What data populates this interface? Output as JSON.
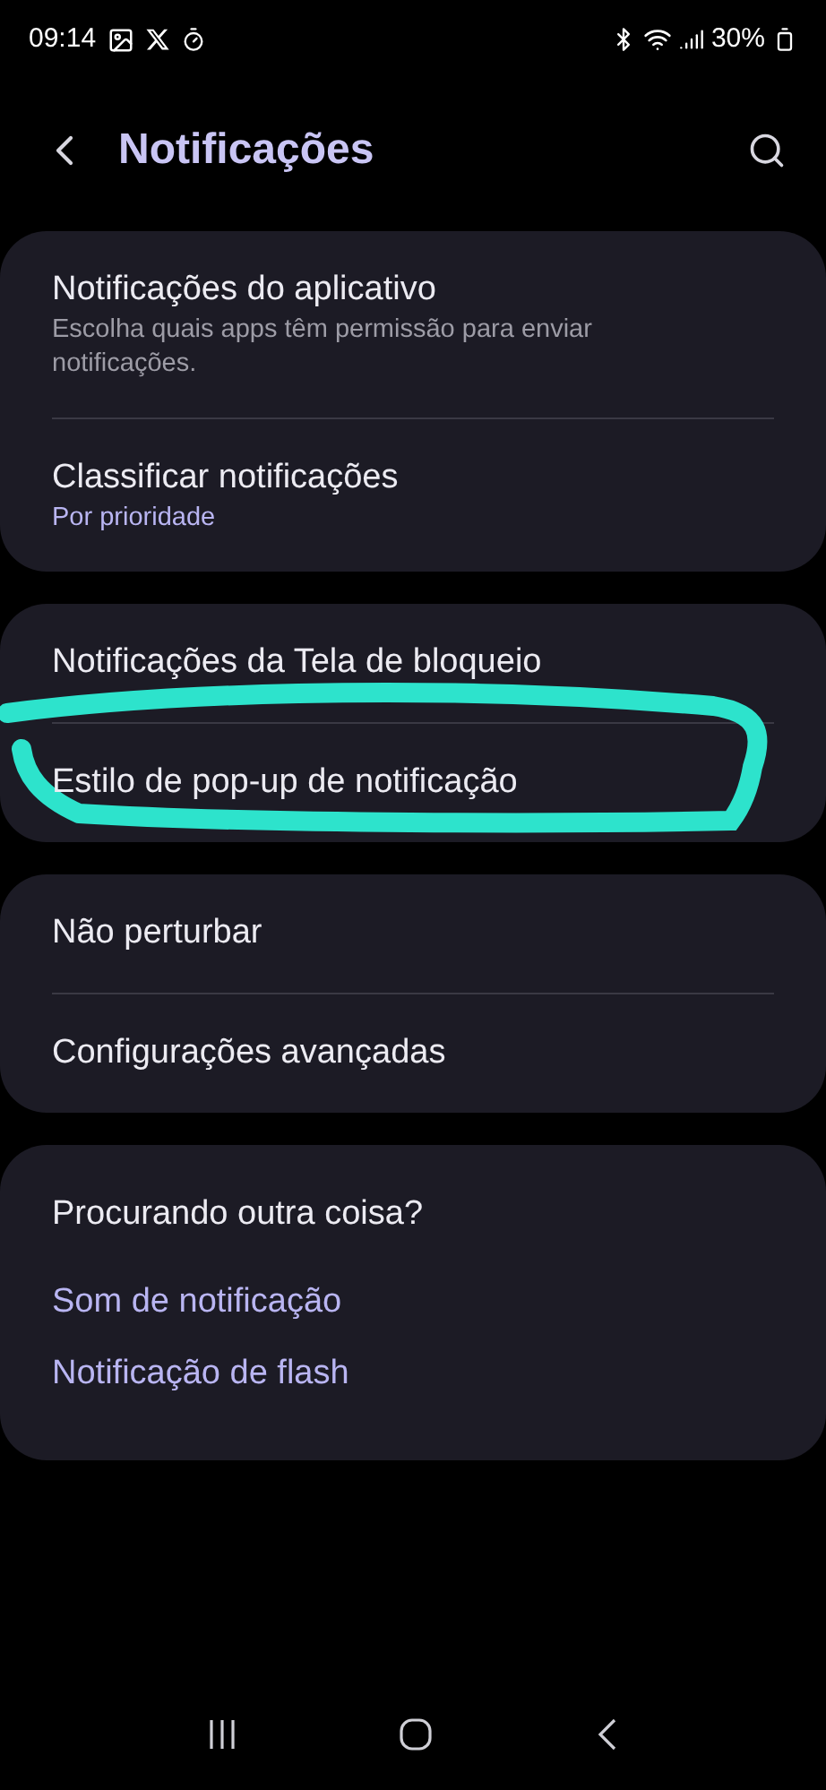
{
  "status_bar": {
    "time": "09:14",
    "battery": "30%"
  },
  "header": {
    "title": "Notificações"
  },
  "groups": [
    {
      "kind": "list",
      "items": [
        {
          "title": "Notificações do aplicativo",
          "subtitle": "Escolha quais apps têm permissão para enviar notificações.",
          "kind": "description"
        },
        {
          "title": "Classificar notificações",
          "subtitle": "Por prioridade",
          "kind": "value"
        }
      ]
    },
    {
      "kind": "list",
      "items": [
        {
          "title": "Notificações da Tela de bloqueio"
        },
        {
          "title": "Estilo de pop-up de notificação",
          "highlighted": true
        }
      ]
    },
    {
      "kind": "list",
      "items": [
        {
          "title": "Não perturbar"
        },
        {
          "title": "Configurações avançadas"
        }
      ]
    },
    {
      "kind": "suggestions",
      "heading": "Procurando outra coisa?",
      "links": [
        "Som de notificação",
        "Notificação de flash"
      ]
    }
  ]
}
